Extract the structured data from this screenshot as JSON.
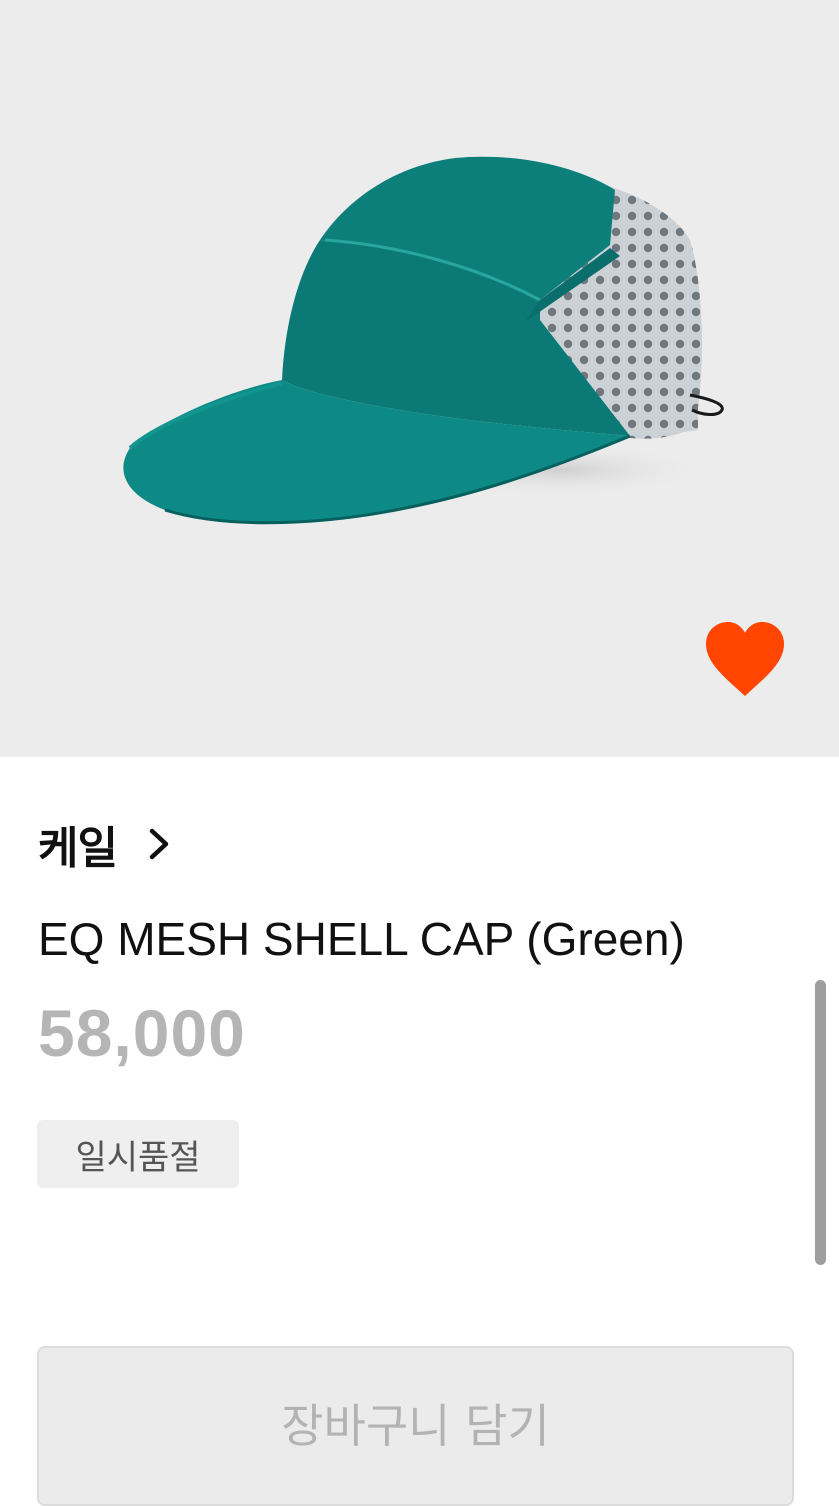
{
  "product": {
    "image_alt": "EQ MESH SHELL CAP (Green)",
    "brand": "케일",
    "title": "EQ MESH SHELL CAP (Green)",
    "price": "58,000",
    "status_badge": "일시품절",
    "cart_button_label": "장바구니 담기"
  },
  "icons": {
    "wishlist": "heart-icon",
    "brand_link": "chevron-right-icon"
  },
  "colors": {
    "heart": "#ff4500",
    "cap_teal": "#0e8a86",
    "mesh": "#c9ced4",
    "price": "#b5b5b5"
  }
}
